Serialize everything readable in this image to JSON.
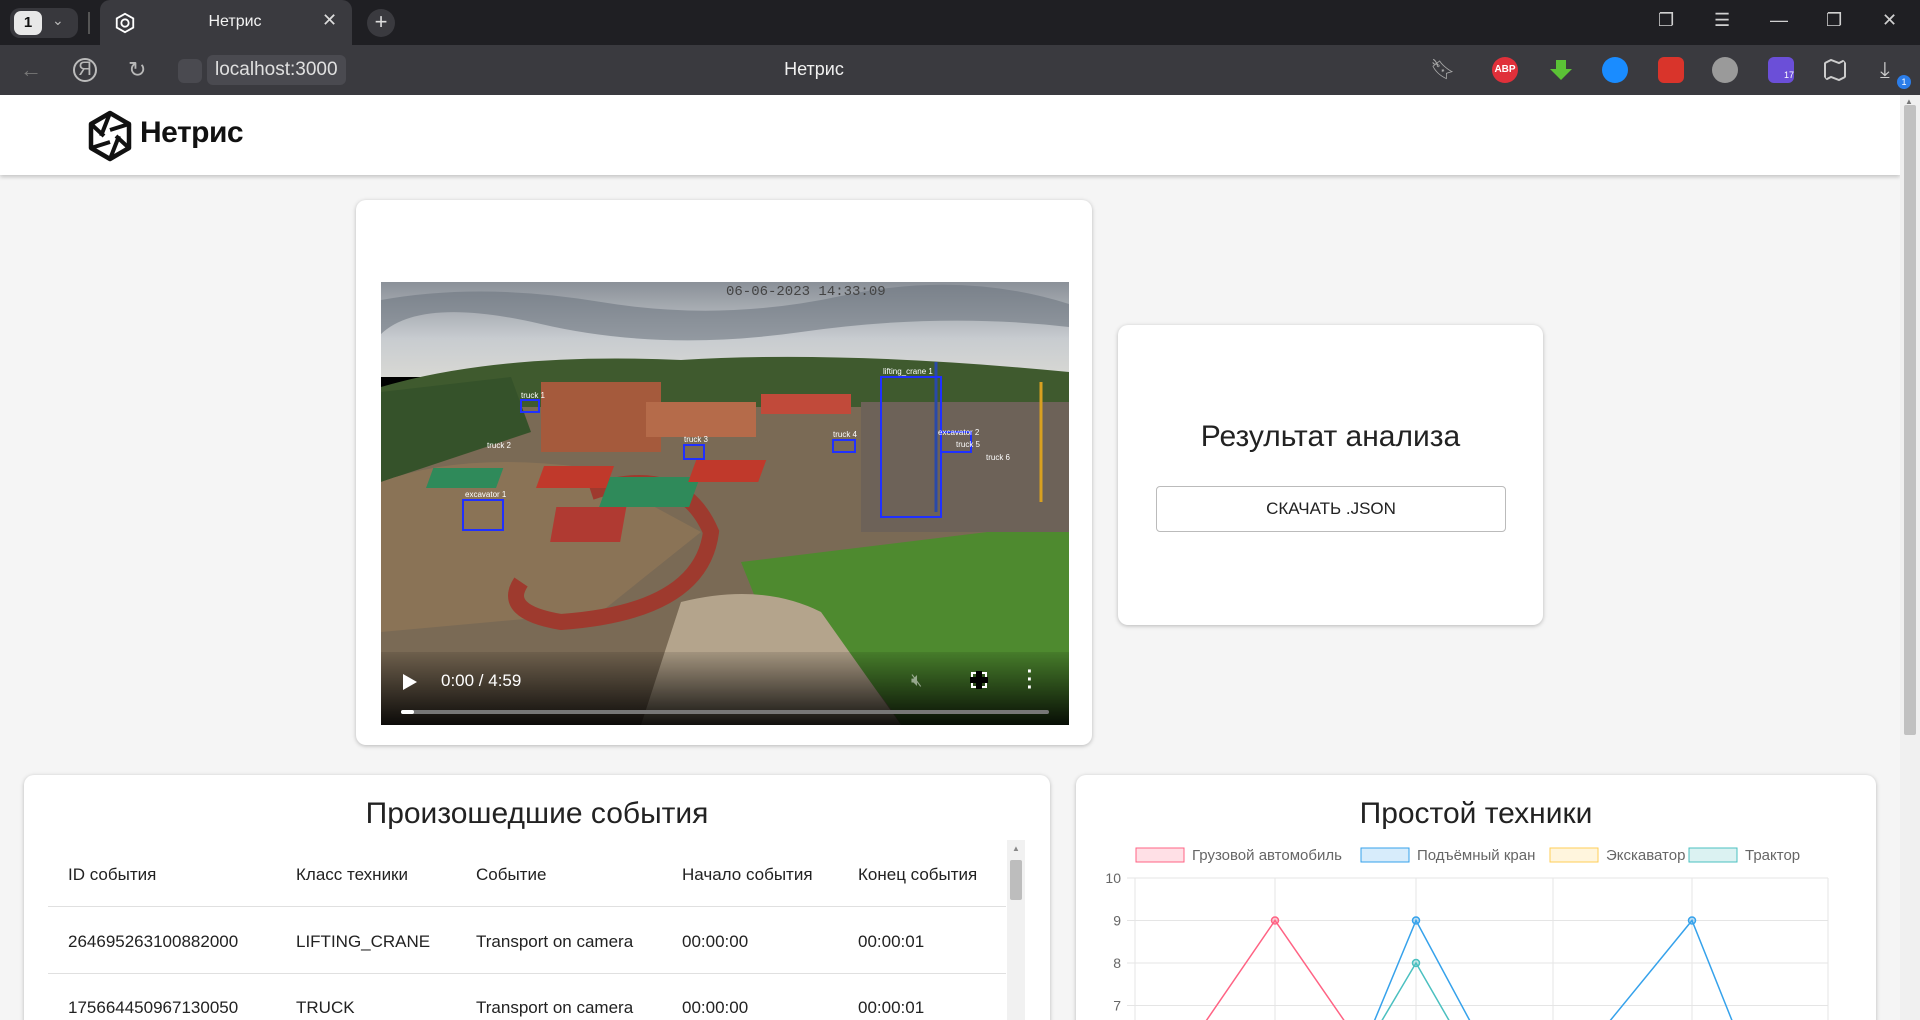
{
  "browser": {
    "tab_count": "1",
    "tab_title": "Нетрис",
    "url": "localhost:3000",
    "page_title": "Нетрис",
    "extensions": [
      "abp-icon",
      "download-arrow-icon",
      "shazam-icon",
      "paw-icon",
      "globe-icon",
      "graduation-hat-icon",
      "map-icon"
    ],
    "abp_label": "ABP",
    "hat_badge": "17",
    "downloads_badge": "1"
  },
  "header": {
    "brand_name": "Нетрис"
  },
  "video": {
    "timestamp": "06-06-2023 14:33:09",
    "time_display": "0:00 / 4:59",
    "progress": 0.02,
    "detections": [
      "truck 1",
      "truck 2",
      "truck 3",
      "truck 4",
      "truck 5",
      "truck 6",
      "excavator 1",
      "excavator 2",
      "lifting_crane 1"
    ]
  },
  "result": {
    "title": "Результат анализа",
    "download_label": "СКАЧАТЬ .JSON"
  },
  "events": {
    "title": "Произошедшие события",
    "columns": [
      "ID события",
      "Класс техники",
      "Событие",
      "Начало события",
      "Конец события"
    ],
    "rows": [
      [
        "264695263100882000",
        "LIFTING_CRANE",
        "Transport on camera",
        "00:00:00",
        "00:00:01"
      ],
      [
        "175664450967130050",
        "TRUCK",
        "Transport on camera",
        "00:00:00",
        "00:00:01"
      ]
    ]
  },
  "chart_data": {
    "type": "line",
    "title": "Простой техники",
    "xlabel": "",
    "ylabel": "",
    "ylim": [
      6,
      10
    ],
    "yticks": [
      "10",
      "9",
      "8",
      "7"
    ],
    "legend_position": "top",
    "grid": true,
    "x": [
      0,
      1,
      2,
      3,
      4,
      5
    ],
    "series": [
      {
        "name": "Грузовой автомобиль",
        "color": "#ff6384",
        "values": [
          null,
          9,
          null,
          null,
          null,
          null
        ],
        "segments": [
          [
            [
              0.5,
              6.6
            ],
            [
              1,
              9
            ],
            [
              1.5,
              6.6
            ]
          ]
        ]
      },
      {
        "name": "Подъёмный кран",
        "color": "#36a2eb",
        "values": [
          null,
          null,
          9,
          null,
          9,
          null
        ],
        "segments": [
          [
            [
              1.7,
              6.6
            ],
            [
              2,
              9
            ],
            [
              2.4,
              6.6
            ]
          ],
          [
            [
              3.4,
              6.6
            ],
            [
              4,
              9
            ],
            [
              4.3,
              6.6
            ]
          ]
        ]
      },
      {
        "name": "Экскаватор",
        "color": "#ffce56",
        "values": [],
        "segments": []
      },
      {
        "name": "Трактор",
        "color": "#4bc0c0",
        "values": [
          null,
          null,
          8,
          null,
          null,
          null
        ],
        "segments": [
          [
            [
              1.75,
              6.6
            ],
            [
              2,
              8
            ],
            [
              2.25,
              6.6
            ]
          ]
        ]
      }
    ]
  }
}
